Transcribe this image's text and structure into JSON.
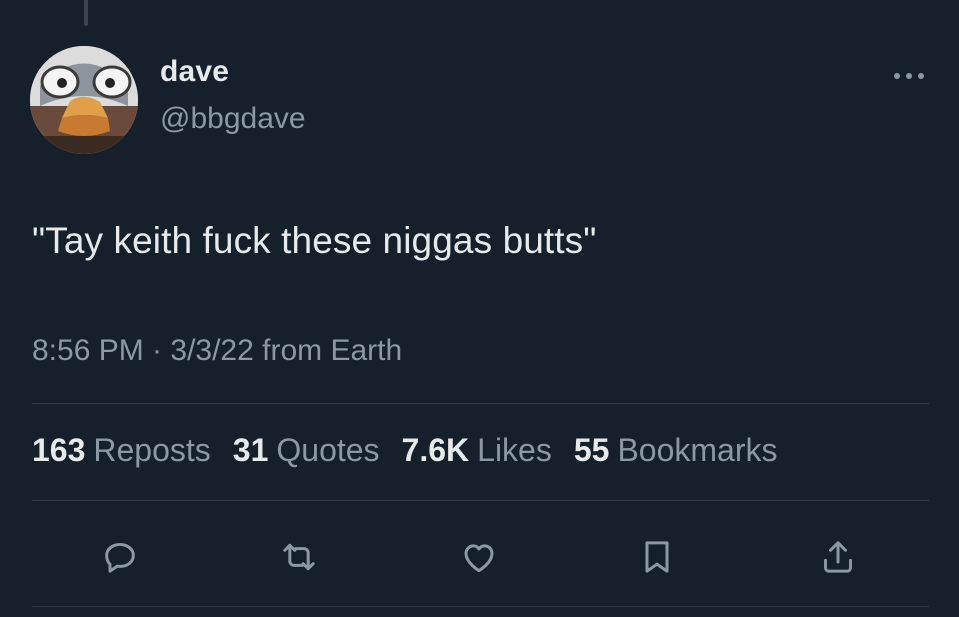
{
  "tweet": {
    "author": {
      "display_name": "dave",
      "handle": "@bbgdave"
    },
    "text": "\"Tay keith fuck these niggas butts\"",
    "meta": "8:56 PM · 3/3/22 from Earth",
    "stats": [
      {
        "count": "163",
        "label": "Reposts"
      },
      {
        "count": "31",
        "label": "Quotes"
      },
      {
        "count": "7.6K",
        "label": "Likes"
      },
      {
        "count": "55",
        "label": "Bookmarks"
      }
    ]
  },
  "icons": {
    "more": "more-horizontal-icon",
    "reply": "reply-icon",
    "repost": "repost-icon",
    "like": "heart-icon",
    "bookmark": "bookmark-icon",
    "share": "share-icon"
  },
  "colors": {
    "background": "#15202b",
    "text_primary": "#e7e9ea",
    "text_secondary": "#8b98a5",
    "divider": "#2f3942"
  }
}
